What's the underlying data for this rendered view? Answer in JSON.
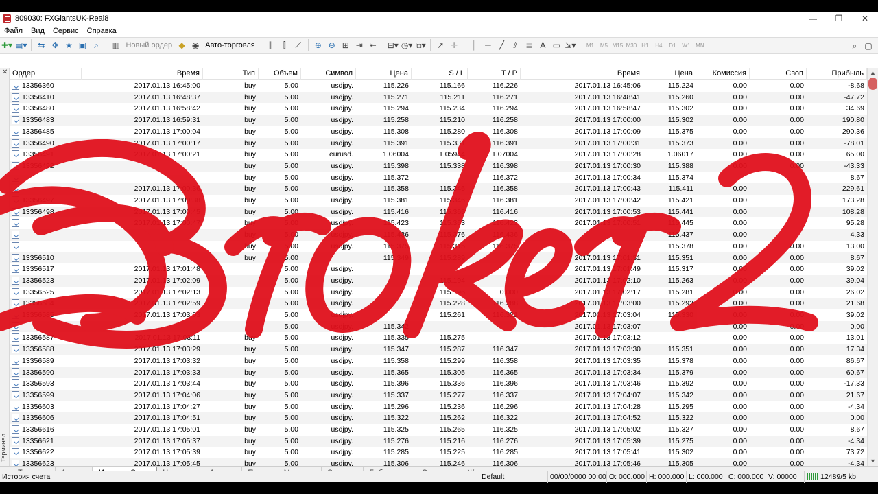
{
  "window": {
    "title": "809030: FXGiantsUK-Real8",
    "controls": [
      "—",
      "❐",
      "✕"
    ]
  },
  "menu": [
    "Файл",
    "Вид",
    "Сервис",
    "Справка"
  ],
  "toolbar": {
    "new_order": "Новый ордер",
    "autotrading": "Авто-торговля",
    "timeframes": [
      "M1",
      "M5",
      "M15",
      "M30",
      "H1",
      "H4",
      "D1",
      "W1",
      "MN"
    ]
  },
  "columns": [
    "Ордер",
    "Время",
    "Тип",
    "Объем",
    "Символ",
    "Цена",
    "S / L",
    "T / P",
    "Время",
    "Цена",
    "Комиссия",
    "Своп",
    "Прибыль"
  ],
  "rows": [
    [
      "13356360",
      "2017.01.13 16:45:00",
      "buy",
      "5.00",
      "usdjpy.",
      "115.226",
      "115.166",
      "116.226",
      "2017.01.13 16:45:06",
      "115.224",
      "0.00",
      "0.00",
      "-8.68"
    ],
    [
      "13356410",
      "2017.01.13 16:48:37",
      "buy",
      "5.00",
      "usdjpy.",
      "115.271",
      "115.211",
      "116.271",
      "2017.01.13 16:48:41",
      "115.260",
      "0.00",
      "0.00",
      "-47.72"
    ],
    [
      "13356480",
      "2017.01.13 16:58:42",
      "buy",
      "5.00",
      "usdjpy.",
      "115.294",
      "115.234",
      "116.294",
      "2017.01.13 16:58:47",
      "115.302",
      "0.00",
      "0.00",
      "34.69"
    ],
    [
      "13356483",
      "2017.01.13 16:59:31",
      "buy",
      "5.00",
      "usdjpy.",
      "115.258",
      "115.210",
      "116.258",
      "2017.01.13 17:00:00",
      "115.302",
      "0.00",
      "0.00",
      "190.80"
    ],
    [
      "13356485",
      "2017.01.13 17:00:04",
      "buy",
      "5.00",
      "usdjpy.",
      "115.308",
      "115.280",
      "116.308",
      "2017.01.13 17:00:09",
      "115.375",
      "0.00",
      "0.00",
      "290.36"
    ],
    [
      "13356490",
      "2017.01.13 17:00:17",
      "buy",
      "5.00",
      "usdjpy.",
      "115.391",
      "115.331",
      "116.391",
      "2017.01.13 17:00:31",
      "115.373",
      "0.00",
      "0.00",
      "-78.01"
    ],
    [
      "13356491",
      "2017.01.13 17:00:21",
      "buy",
      "5.00",
      "eurusd.",
      "1.06004",
      "1.05944",
      "1.07004",
      "2017.01.13 17:00:28",
      "1.06017",
      "0.00",
      "0.00",
      "65.00"
    ],
    [
      "13356492",
      "",
      "buy",
      "5.00",
      "usdjpy.",
      "115.398",
      "115.338",
      "116.398",
      "2017.01.13 17:00:30",
      "115.388",
      "0.00",
      "0.00",
      "-43.33"
    ],
    [
      "",
      "",
      "buy",
      "5.00",
      "usdjpy.",
      "115.372",
      "",
      "116.372",
      "2017.01.13 17:00:34",
      "115.374",
      "",
      "",
      "8.67"
    ],
    [
      "",
      "2017.01.13 17:00:36",
      "buy",
      "5.00",
      "usdjpy.",
      "115.358",
      "115.346",
      "116.358",
      "2017.01.13 17:00:43",
      "115.411",
      "0.00",
      "",
      "229.61"
    ],
    [
      "13356497",
      "2017.01.13 17:00:38",
      "buy",
      "5.00",
      "usdjpy.",
      "115.381",
      "115.346",
      "116.381",
      "2017.01.13 17:00:42",
      "115.421",
      "0.00",
      "",
      "173.28"
    ],
    [
      "13356498",
      "2017.01.13 17:00:45",
      "buy",
      "5.00",
      "usdjpy.",
      "115.416",
      "115.365",
      "116.416",
      "2017.01.13 17:00:53",
      "115.441",
      "0.00",
      "",
      "108.28"
    ],
    [
      "",
      "2017.01.13 17:00:47",
      "buy",
      "5.00",
      "usdjpy.",
      "115.423",
      "115.363",
      "116.423",
      "2017.01.13 17:00:51",
      "115.445",
      "0.00",
      "",
      "95.28"
    ],
    [
      "",
      "",
      "buy",
      "5.00",
      "usdjpy.",
      "115.436",
      "115.376",
      "116.436",
      "",
      "115.437",
      "0.00",
      "",
      "4.33"
    ],
    [
      "",
      "",
      "buy",
      "5.00",
      "usdjpy.",
      "115.375",
      "115.315",
      "116.375",
      "",
      "115.378",
      "0.00",
      "0.00",
      "13.00"
    ],
    [
      "13356510",
      "",
      "buy",
      "5.00",
      "",
      "115.349",
      "115.289",
      "",
      "2017.01.13 17:01:31",
      "115.351",
      "0.00",
      "0.00",
      "8.67"
    ],
    [
      "13356517",
      "2017.01.13 17:01:48",
      "",
      "5.00",
      "usdjpy.",
      "",
      "",
      "",
      "2017.01.13 17:01:49",
      "115.317",
      "0.00",
      "0.00",
      "39.02"
    ],
    [
      "13356523",
      "2017.01.13 17:02:09",
      "",
      "5.00",
      "usdjpy.",
      "",
      "115.194",
      "",
      "2017.01.13 17:02:10",
      "115.263",
      "0.00",
      "0.00",
      "39.04"
    ],
    [
      "13356525",
      "2017.01.13 17:02:13",
      "",
      "5.00",
      "usdjpy.",
      "",
      "115.196",
      "0.000",
      "2017.01.13 17:02:17",
      "115.281",
      "0.00",
      "0.00",
      "26.02"
    ],
    [
      "13356584",
      "2017.01.13 17:02:59",
      "",
      "5.00",
      "usdjpy.",
      "",
      "115.228",
      "116.288",
      "2017.01.13 17:03:00",
      "115.293",
      "0.00",
      "0.00",
      "21.68"
    ],
    [
      "13356585",
      "2017.01.13 17:03:03",
      "",
      "5.00",
      "usdjpy.",
      "",
      "115.261",
      "116.321",
      "2017.01.13 17:03:04",
      "115.330",
      "0.00",
      "0.00",
      "39.02"
    ],
    [
      "",
      "",
      "",
      "5.00",
      "usdjpy.",
      "115.342",
      "",
      "",
      "2017.01.13 17:03:07",
      "",
      "0.00",
      "0.00",
      "0.00"
    ],
    [
      "13356587",
      "2017.01.13 17:03:11",
      "buy",
      "5.00",
      "usdjpy.",
      "115.335",
      "115.275",
      "",
      "2017.01.13 17:03:12",
      "",
      "0.00",
      "0.00",
      "13.01"
    ],
    [
      "13356588",
      "2017.01.13 17:03:29",
      "buy",
      "5.00",
      "usdjpy.",
      "115.347",
      "115.287",
      "116.347",
      "2017.01.13 17:03:30",
      "115.351",
      "0.00",
      "0.00",
      "17.34"
    ],
    [
      "13356589",
      "2017.01.13 17:03:32",
      "buy",
      "5.00",
      "usdjpy.",
      "115.358",
      "115.299",
      "116.358",
      "2017.01.13 17:03:35",
      "115.378",
      "0.00",
      "0.00",
      "86.67"
    ],
    [
      "13356590",
      "2017.01.13 17:03:33",
      "buy",
      "5.00",
      "usdjpy.",
      "115.365",
      "115.305",
      "116.365",
      "2017.01.13 17:03:34",
      "115.379",
      "0.00",
      "0.00",
      "60.67"
    ],
    [
      "13356593",
      "2017.01.13 17:03:44",
      "buy",
      "5.00",
      "usdjpy.",
      "115.396",
      "115.336",
      "116.396",
      "2017.01.13 17:03:46",
      "115.392",
      "0.00",
      "0.00",
      "-17.33"
    ],
    [
      "13356599",
      "2017.01.13 17:04:06",
      "buy",
      "5.00",
      "usdjpy.",
      "115.337",
      "115.277",
      "116.337",
      "2017.01.13 17:04:07",
      "115.342",
      "0.00",
      "0.00",
      "21.67"
    ],
    [
      "13356603",
      "2017.01.13 17:04:27",
      "buy",
      "5.00",
      "usdjpy.",
      "115.296",
      "115.236",
      "116.296",
      "2017.01.13 17:04:28",
      "115.295",
      "0.00",
      "0.00",
      "-4.34"
    ],
    [
      "13356606",
      "2017.01.13 17:04:51",
      "buy",
      "5.00",
      "usdjpy.",
      "115.322",
      "115.262",
      "116.322",
      "2017.01.13 17:04:52",
      "115.322",
      "0.00",
      "0.00",
      "0.00"
    ],
    [
      "13356616",
      "2017.01.13 17:05:01",
      "buy",
      "5.00",
      "usdjpy.",
      "115.325",
      "115.265",
      "116.325",
      "2017.01.13 17:05:02",
      "115.327",
      "0.00",
      "0.00",
      "8.67"
    ],
    [
      "13356621",
      "2017.01.13 17:05:37",
      "buy",
      "5.00",
      "usdjpy.",
      "115.276",
      "115.216",
      "116.276",
      "2017.01.13 17:05:39",
      "115.275",
      "0.00",
      "0.00",
      "-4.34"
    ],
    [
      "13356622",
      "2017.01.13 17:05:39",
      "buy",
      "5.00",
      "usdjpy.",
      "115.285",
      "115.225",
      "116.285",
      "2017.01.13 17:05:41",
      "115.302",
      "0.00",
      "0.00",
      "73.72"
    ],
    [
      "13356623",
      "2017.01.13 17:05:45",
      "buy",
      "5.00",
      "usdjpy.",
      "115.306",
      "115.246",
      "116.306",
      "2017.01.13 17:05:46",
      "115.305",
      "0.00",
      "0.00",
      "-4.34"
    ]
  ],
  "terminal_label": "Терминал",
  "tabs": [
    {
      "label": "Торговля",
      "badge": ""
    },
    {
      "label": "Активы",
      "badge": ""
    },
    {
      "label": "История Счета",
      "badge": "",
      "active": true
    },
    {
      "label": "Новости",
      "badge": "99"
    },
    {
      "label": "Алерты",
      "badge": ""
    },
    {
      "label": "Почта",
      "badge": "6"
    },
    {
      "label": "Маркет",
      "badge": "80"
    },
    {
      "label": "Сигналы",
      "badge": ""
    },
    {
      "label": "Библиотека",
      "badge": ""
    },
    {
      "label": "Эксперты",
      "badge": ""
    },
    {
      "label": "Журнал",
      "badge": ""
    }
  ],
  "status": {
    "left": "История счета",
    "profile": "Default",
    "datetime": "00/00/0000 00:00",
    "open": "O: 000.000",
    "high": "H: 000.000",
    "low": "L: 000.000",
    "close": "C: 000.000",
    "volume": "V: 00000",
    "traffic": "12489/5 kb"
  },
  "watermark": {
    "text": "Broker 2",
    "color": "#e0101c"
  }
}
